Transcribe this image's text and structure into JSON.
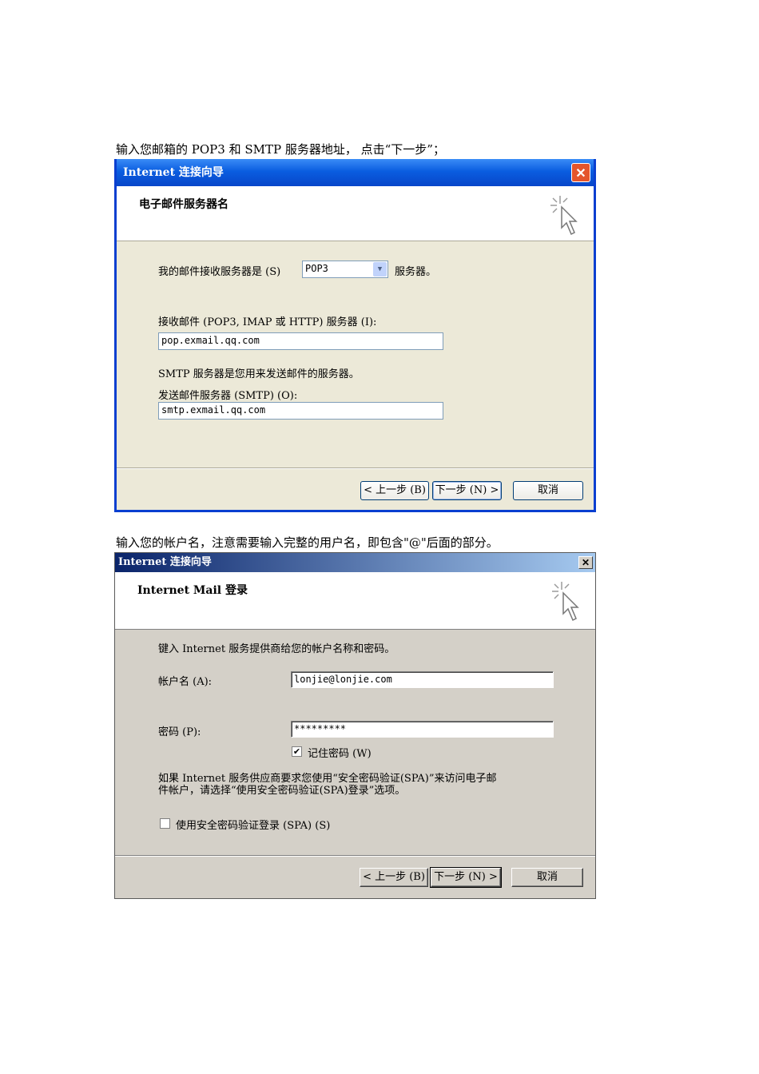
{
  "captions": {
    "first": "输入您邮箱的 POP3 和 SMTP 服务器地址， 点击“下一步”；",
    "second": "输入您的帐户名，注意需要输入完整的用户名，即包含\"@\"后面的部分。"
  },
  "dialog1": {
    "title": "Internet 连接向导",
    "close": "✕",
    "header": "电子邮件服务器名",
    "incoming_type_label": "我的邮件接收服务器是 (S)",
    "incoming_type_value": "POP3",
    "incoming_type_suffix": "服务器。",
    "incoming_label": "接收邮件 (POP3, IMAP 或 HTTP) 服务器 (I):",
    "incoming_value": "pop.exmail.qq.com",
    "smtp_note": "SMTP 服务器是您用来发送邮件的服务器。",
    "outgoing_label": "发送邮件服务器 (SMTP) (O):",
    "outgoing_value": "smtp.exmail.qq.com",
    "back": "< 上一步 (B)",
    "next": "下一步 (N) >",
    "cancel": "取消"
  },
  "dialog2": {
    "title": "Internet 连接向导",
    "close": "✕",
    "header": "Internet Mail 登录",
    "intro": "键入 Internet 服务提供商给您的帐户名称和密码。",
    "account_label": "帐户名 (A):",
    "account_value": "lonjie@lonjie.com",
    "password_label": "密码 (P):",
    "password_value": "*********",
    "remember_label": "记住密码 (W)",
    "remember_checked": true,
    "spa_note_line1": "如果 Internet 服务供应商要求您使用“安全密码验证(SPA)”来访问电子邮",
    "spa_note_line2": "件帐户，请选择“使用安全密码验证(SPA)登录”选项。",
    "spa_label": "使用安全密码验证登录 (SPA) (S)",
    "spa_checked": false,
    "back": "< 上一步 (B)",
    "next": "下一步 (N) >",
    "cancel": "取消"
  }
}
